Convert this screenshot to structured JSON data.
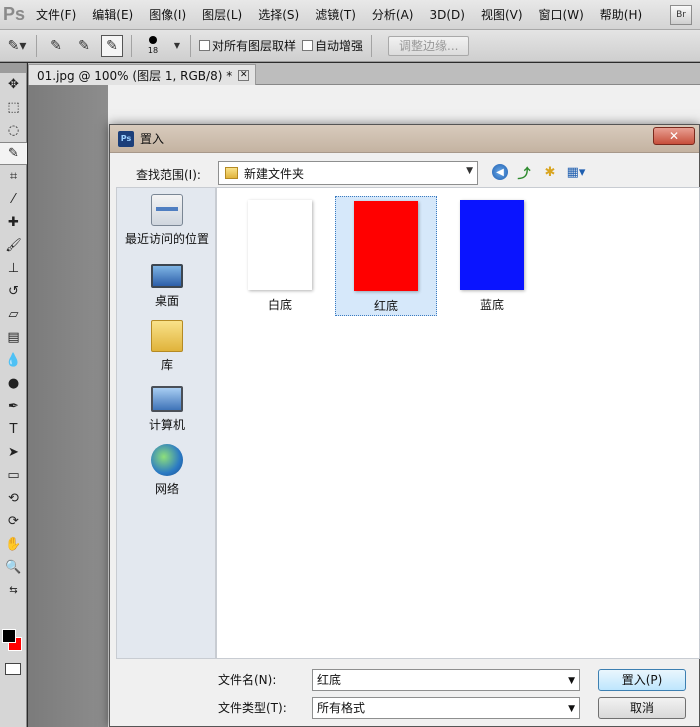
{
  "app": {
    "logo": "Ps",
    "menu": [
      "文件(F)",
      "编辑(E)",
      "图像(I)",
      "图层(L)",
      "选择(S)",
      "滤镜(T)",
      "分析(A)",
      "3D(D)",
      "视图(V)",
      "窗口(W)",
      "帮助(H)"
    ],
    "bridge_button": "Br"
  },
  "options": {
    "brush_size": "18",
    "sample_all_layers": "对所有图层取样",
    "auto_enhance": "自动增强",
    "refine_edge": "调整边缘..."
  },
  "document": {
    "tab_title": "01.jpg @ 100% (图层 1, RGB/8) *",
    "tab_close": "✕"
  },
  "colors": {
    "foreground": "#000000",
    "background": "#ff0000"
  },
  "dialog": {
    "title": "置入",
    "title_icon": "Ps",
    "close": "✕",
    "look_in_label": "查找范围(I):",
    "look_in_value": "新建文件夹",
    "places": [
      {
        "label": "最近访问的位置",
        "icon": "recent-places-icon"
      },
      {
        "label": "桌面",
        "icon": "desktop-icon"
      },
      {
        "label": "库",
        "icon": "libraries-icon"
      },
      {
        "label": "计算机",
        "icon": "computer-icon"
      },
      {
        "label": "网络",
        "icon": "network-icon"
      }
    ],
    "files": [
      {
        "name": "白底",
        "color": "#ffffff",
        "selected": false
      },
      {
        "name": "红底",
        "color": "#ff0000",
        "selected": true
      },
      {
        "name": "蓝底",
        "color": "#0a14ff",
        "selected": false
      }
    ],
    "filename_label": "文件名(N):",
    "filename_value": "红底",
    "filetype_label": "文件类型(T):",
    "filetype_value": "所有格式",
    "place_button": "置入(P)",
    "cancel_button": "取消"
  }
}
